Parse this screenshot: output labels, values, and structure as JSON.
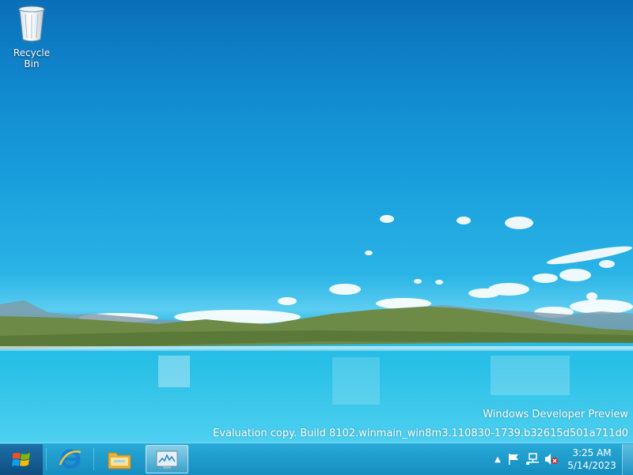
{
  "desktop": {
    "icons": [
      {
        "label": "Recycle Bin",
        "icon": "recycle-bin-icon"
      }
    ],
    "watermark": {
      "line1": "Windows Developer Preview",
      "line2": "Evaluation copy. Build 8102.winmain_win8m3.110830-1739.b32615d501a711d0"
    }
  },
  "taskbar": {
    "start": {
      "icon": "windows-logo-icon"
    },
    "pinned": [
      {
        "name": "Internet Explorer",
        "icon": "internet-explorer-icon"
      },
      {
        "name": "Windows Explorer",
        "icon": "folder-icon"
      },
      {
        "name": "Task Manager",
        "icon": "task-manager-icon",
        "active": true
      }
    ],
    "tray": {
      "icons": [
        "show-hidden-icons-chevron",
        "action-center-flag-icon",
        "network-icon",
        "volume-muted-icon"
      ],
      "time": "3:25 AM",
      "date": "5/14/2023"
    }
  },
  "colors": {
    "sky_top": "#0a6fb8",
    "water": "#28bfe6",
    "taskbar": "#1c9ccc"
  }
}
